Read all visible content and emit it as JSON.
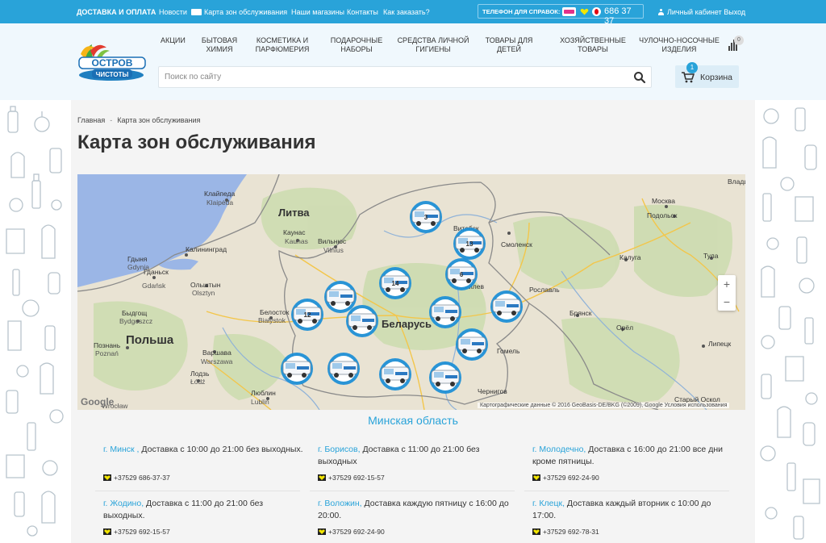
{
  "topbar": {
    "delivery": "ДОСТАВКА И ОПЛАТА",
    "news": "Новости",
    "zones": "Карта зон обслуживания",
    "shops": "Наши магазины",
    "contacts": "Контакты",
    "howto": "Как заказать?",
    "phone_label": "ТЕЛЕФОН ДЛЯ СПРАВОК:",
    "phone_number": "686 37 37",
    "cabinet": "Личный кабинет",
    "logout": "Выход"
  },
  "logo": {
    "line1": "ОСТРОВ",
    "line2": "ЧИСТОТЫ"
  },
  "nav": [
    "АКЦИИ",
    "БЫТОВАЯ ХИМИЯ",
    "КОСМЕТИКА И ПАРФЮМЕРИЯ",
    "ПОДАРОЧНЫЕ НАБОРЫ",
    "СРЕДСТВА ЛИЧНОЙ ГИГИЕНЫ",
    "ТОВАРЫ ДЛЯ ДЕТЕЙ",
    "ХОЗЯЙСТВЕННЫЕ ТОВАРЫ",
    "ЧУЛОЧНО-НОСОЧНЫЕ ИЗДЕЛИЯ"
  ],
  "compare_count": "0",
  "search": {
    "placeholder": "Поиск по сайту"
  },
  "cart": {
    "label": "Корзина",
    "count": "1"
  },
  "breadcrumb": {
    "home": "Главная",
    "current": "Карта зон обслуживания"
  },
  "page_title": "Карта зон обслуживания",
  "map": {
    "labels": {
      "lithuania": "Литва",
      "belarus": "Беларусь",
      "poland": "Польша",
      "klaipeda": "Клайпеда",
      "klaipeda_en": "Klaipėda",
      "kaunas": "Каунас",
      "kaunas_en": "Kaunas",
      "vilnius": "Вильнюс",
      "vilnius_en": "Vilnius",
      "kaliningrad": "Калининград",
      "gdansk": "Гданьск",
      "gdansk_en": "Gdańsk",
      "olsztyn": "Ольштын",
      "olsztyn_en": "Olsztyn",
      "bydgoszcz": "Быдгощ",
      "bydgoszcz_en": "Bydgoszcz",
      "bialystok": "Белосток",
      "bialystok_en": "Białystok",
      "poznan": "Познань",
      "poznan_en": "Poznań",
      "warsaw": "Варшава",
      "warsaw_en": "Warszawa",
      "lodz": "Лодзь",
      "lodz_en": "Łódź",
      "lublin": "Люблин",
      "lublin_en": "Lublin",
      "wroclaw": "Wrocław",
      "gdynia": "Гдыня",
      "gdynia_en": "Gdynia",
      "smolensk": "Смоленск",
      "vitebsk": "Витебск",
      "mogilev": "Могилев",
      "moscow": "Москва",
      "podolsk": "Подольск",
      "kaluga": "Калуга",
      "tula": "Тула",
      "bryansk": "Брянск",
      "orel": "Орёл",
      "lipetsk": "Липецк",
      "vladimir": "Влади",
      "gomel": "Гомель",
      "chernigov": "Чернигов",
      "stary_oskol": "Старый Оскол",
      "roslavl": "Рославль"
    },
    "markers": [
      "3",
      "13",
      "6",
      "14",
      "12",
      "",
      "",
      "",
      "",
      "",
      "",
      "",
      "",
      ""
    ],
    "zoom_in": "+",
    "zoom_out": "−",
    "google": "Google",
    "attribution": "Картографические данные © 2016 GeoBasis-DE/BKG (©2009), Google   Условия использования"
  },
  "region": "Минская область",
  "deliveries": [
    {
      "city": "г. Минск ,",
      "text": " Доставка с 10:00 до 21:00 без выходных.",
      "phone": "+37529 686-37-37"
    },
    {
      "city": "г. Борисов,",
      "text": " Доставка с 11:00 до 21:00 без выходных",
      "phone": "+37529 692-15-57"
    },
    {
      "city": "г. Молодечно,",
      "text": " Доставка с 16:00 до 21:00 все дни кроме пятницы.",
      "phone": "+37529 692-24-90"
    },
    {
      "city": "г. Жодино,",
      "text": " Доставка с 11:00 до 21:00 без выходных.",
      "phone": "+37529 692-15-57"
    },
    {
      "city": "г. Воложин,",
      "text": " Доставка каждую пятницу с 16:00 до 20:00.",
      "phone": "+37529 692-24-90"
    },
    {
      "city": "г. Клецк,",
      "text": " Доставка каждый вторник с 10:00 до 17:00.",
      "phone": "+37529 692-78-31"
    }
  ]
}
